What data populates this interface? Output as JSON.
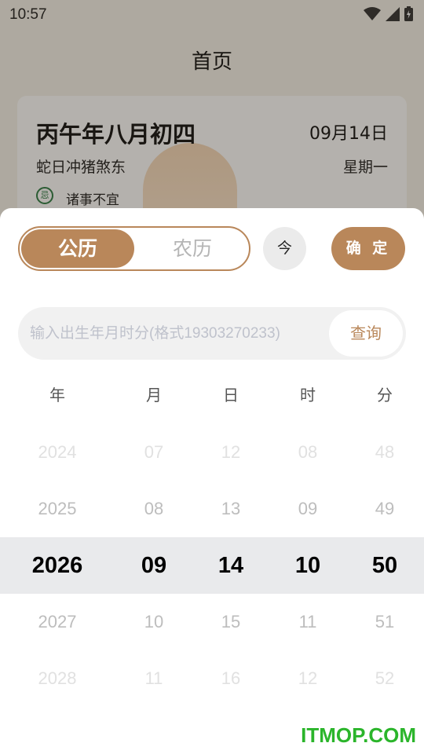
{
  "status": {
    "time": "10:57"
  },
  "page": {
    "title": "首页"
  },
  "card": {
    "lunar_date": "丙午年八月初四",
    "solar_date": "09月14日",
    "day_desc": "蛇日冲猪煞东",
    "weekday": "星期一",
    "avoid_badge": "忌",
    "avoid_text": "诸事不宜"
  },
  "sheet": {
    "tabs": [
      {
        "label": "公历",
        "active": true
      },
      {
        "label": "农历",
        "active": false
      }
    ],
    "today_label": "今",
    "confirm_label": "确 定",
    "search": {
      "placeholder": "输入出生年月时分(格式19303270233)",
      "value": "",
      "button": "查询"
    },
    "columns": [
      {
        "head": "年",
        "values": [
          "2024",
          "2025",
          "2026",
          "2027",
          "2028"
        ]
      },
      {
        "head": "月",
        "values": [
          "07",
          "08",
          "09",
          "10",
          "11"
        ]
      },
      {
        "head": "日",
        "values": [
          "12",
          "13",
          "14",
          "15",
          "16"
        ]
      },
      {
        "head": "时",
        "values": [
          "08",
          "09",
          "10",
          "11",
          "12"
        ]
      },
      {
        "head": "分",
        "values": [
          "48",
          "49",
          "50",
          "51",
          "52"
        ]
      }
    ],
    "selected_index": 2
  },
  "watermark": "ITMOP.COM",
  "colors": {
    "accent": "#b9875a",
    "highlight": "#e9eaec",
    "watermark": "#2bb52b"
  }
}
